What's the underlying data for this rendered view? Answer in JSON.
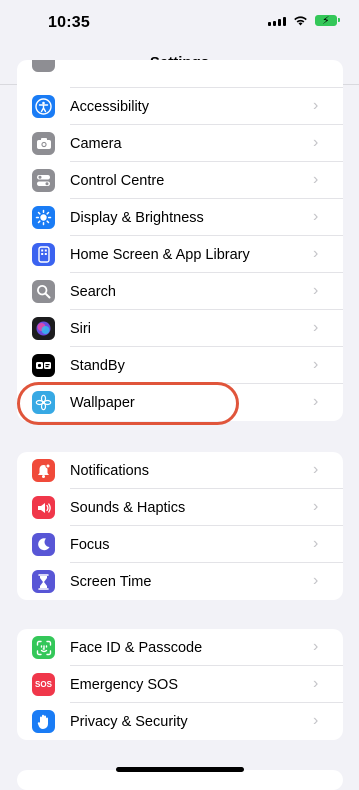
{
  "status": {
    "time": "10:35"
  },
  "nav": {
    "title": "Settings"
  },
  "groups": [
    {
      "items": [
        {
          "label": "",
          "icon": "partial-icon",
          "color": "#8e8e93"
        },
        {
          "label": "Accessibility",
          "icon": "accessibility-icon",
          "color": "#1a7cf5"
        },
        {
          "label": "Camera",
          "icon": "camera-icon",
          "color": "#8e8e93"
        },
        {
          "label": "Control Centre",
          "icon": "control-centre-icon",
          "color": "#8e8e93"
        },
        {
          "label": "Display & Brightness",
          "icon": "sun-icon",
          "color": "#1a7cf5"
        },
        {
          "label": "Home Screen & App Library",
          "icon": "home-screen-icon",
          "color": "#3b63f0"
        },
        {
          "label": "Search",
          "icon": "search-icon",
          "color": "#8e8e93"
        },
        {
          "label": "Siri",
          "icon": "siri-icon",
          "color": "#222"
        },
        {
          "label": "StandBy",
          "icon": "standby-icon",
          "color": "#000"
        },
        {
          "label": "Wallpaper",
          "icon": "flower-icon",
          "color": "#37a9e4"
        }
      ]
    },
    {
      "items": [
        {
          "label": "Notifications",
          "icon": "bell-icon",
          "color": "#f04a3a"
        },
        {
          "label": "Sounds & Haptics",
          "icon": "speaker-icon",
          "color": "#f0374a"
        },
        {
          "label": "Focus",
          "icon": "moon-icon",
          "color": "#5856d6"
        },
        {
          "label": "Screen Time",
          "icon": "hourglass-icon",
          "color": "#5856d6"
        }
      ]
    },
    {
      "items": [
        {
          "label": "Face ID & Passcode",
          "icon": "face-id-icon",
          "color": "#34c759"
        },
        {
          "label": "Emergency SOS",
          "icon": "sos-icon",
          "color": "#f0374a",
          "icon_text": "SOS"
        },
        {
          "label": "Privacy & Security",
          "icon": "hand-icon",
          "color": "#1a7cf5"
        }
      ]
    }
  ]
}
